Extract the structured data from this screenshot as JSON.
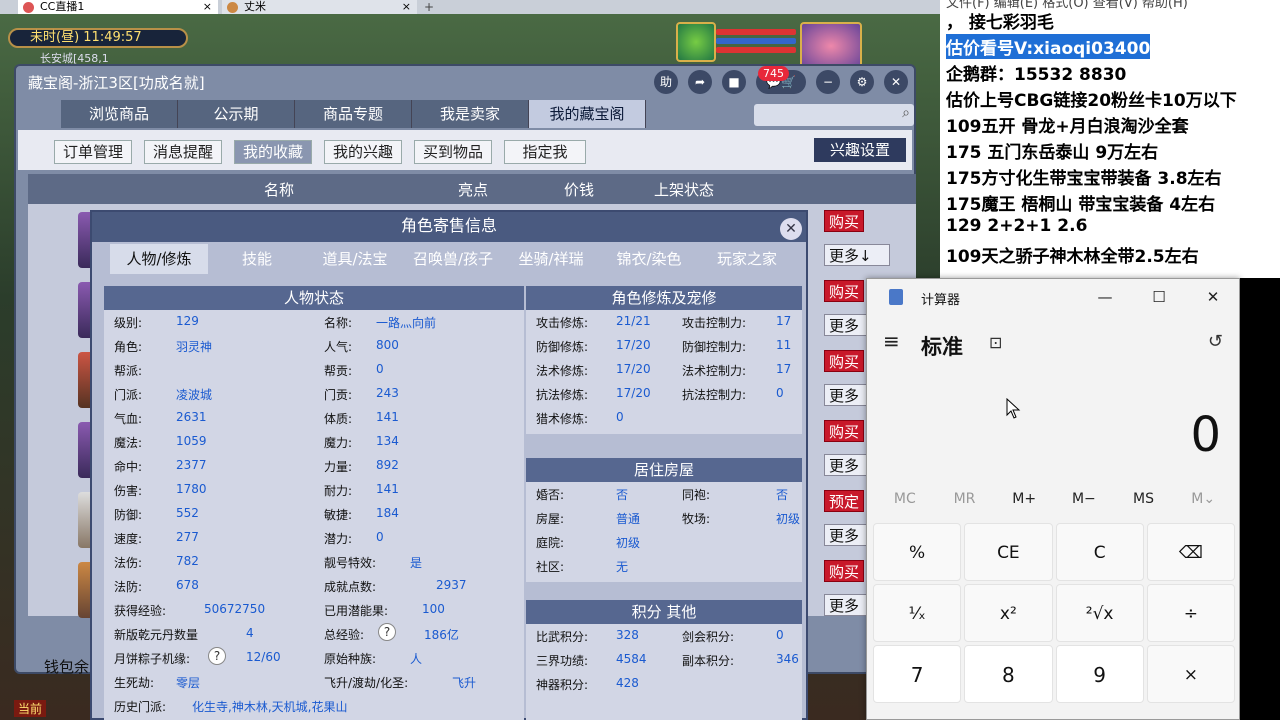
{
  "browser": {
    "tabs": [
      {
        "label": "CC直播1",
        "close": "×"
      },
      {
        "label": "丈米",
        "close": "×"
      }
    ],
    "add": "+"
  },
  "hud": {
    "time": "未时(昼)  11:49:57",
    "location": "长安城[458,1"
  },
  "cbg": {
    "title": "藏宝阁-浙江3区[功成名就]",
    "icons": {
      "help": "助",
      "share": "➦",
      "stop": "■",
      "chat": "💬",
      "cart": "🛒",
      "min": "−",
      "gear": "⚙",
      "close": "✕"
    },
    "badge": "745",
    "nav": [
      "浏览商品",
      "公示期",
      "商品专题",
      "我是卖家",
      "我的藏宝阁"
    ],
    "sub": [
      "订单管理",
      "消息提醒",
      "我的收藏",
      "我的兴趣",
      "买到物品",
      "指定我"
    ],
    "interest": "兴趣设置",
    "cols": [
      "名称",
      "亮点",
      "价钱",
      "上架状态"
    ],
    "buy": [
      "购买",
      "购买",
      "购买",
      "购买",
      "预定",
      "购买"
    ],
    "more": [
      "更多↓",
      "更多",
      "更多",
      "更多",
      "更多",
      "更多"
    ],
    "wallet": "钱包余"
  },
  "role": {
    "title": "角色寄售信息",
    "close": "✕",
    "tabs": [
      "人物/修炼",
      "技能",
      "道具/法宝",
      "召唤兽/孩子",
      "坐骑/祥瑞",
      "锦衣/染色",
      "玩家之家"
    ],
    "status_title": "人物状态",
    "left": [
      [
        "级别:",
        "129"
      ],
      [
        "角色:",
        "羽灵神"
      ],
      [
        "帮派:",
        ""
      ],
      [
        "门派:",
        "凌波城"
      ],
      [
        "气血:",
        "2631"
      ],
      [
        "魔法:",
        "1059"
      ],
      [
        "命中:",
        "2377"
      ],
      [
        "伤害:",
        "1780"
      ],
      [
        "防御:",
        "552"
      ],
      [
        "速度:",
        "277"
      ],
      [
        "法伤:",
        "782"
      ],
      [
        "法防:",
        "678"
      ],
      [
        "获得经验:",
        "50672750"
      ],
      [
        "新版乾元丹数量",
        "4"
      ],
      [
        "月饼粽子机缘:",
        "12/60"
      ],
      [
        "生死劫:",
        "零层"
      ],
      [
        "历史门派:",
        "化生寺,神木林,天机城,花果山"
      ]
    ],
    "mid": [
      [
        "名称:",
        "一路灬向前"
      ],
      [
        "人气:",
        "800"
      ],
      [
        "帮贡:",
        "0"
      ],
      [
        "门贡:",
        "243"
      ],
      [
        "体质:",
        "141"
      ],
      [
        "魔力:",
        "134"
      ],
      [
        "力量:",
        "892"
      ],
      [
        "耐力:",
        "141"
      ],
      [
        "敏捷:",
        "184"
      ],
      [
        "潜力:",
        "0"
      ],
      [
        "靓号特效:",
        "是"
      ],
      [
        "成就点数:",
        "2937"
      ],
      [
        "已用潜能果:",
        "100"
      ],
      [
        "总经验:",
        "186亿"
      ],
      [
        "原始种族:",
        "人"
      ],
      [
        "飞升/渡劫/化圣:",
        "飞升"
      ]
    ],
    "cult_title": "角色修炼及宠修",
    "cult": [
      [
        "攻击修炼:",
        "21/21",
        "攻击控制力:",
        "17"
      ],
      [
        "防御修炼:",
        "17/20",
        "防御控制力:",
        "11"
      ],
      [
        "法术修炼:",
        "17/20",
        "法术控制力:",
        "17"
      ],
      [
        "抗法修炼:",
        "17/20",
        "抗法控制力:",
        "0"
      ],
      [
        "猎术修炼:",
        "0",
        "",
        ""
      ]
    ],
    "house_title": "居住房屋",
    "house": [
      [
        "婚否:",
        "否",
        "同袍:",
        "否"
      ],
      [
        "房屋:",
        "普通",
        "牧场:",
        "初级"
      ],
      [
        "庭院:",
        "初级",
        "",
        ""
      ],
      [
        "社区:",
        "无",
        "",
        ""
      ]
    ],
    "score_title": "积分 其他",
    "score": [
      [
        "比武积分:",
        "328",
        "剑会积分:",
        "0"
      ],
      [
        "三界功绩:",
        "4584",
        "副本积分:",
        "346"
      ],
      [
        "神器积分:",
        "428",
        "",
        ""
      ]
    ],
    "qm": "?"
  },
  "overlay": {
    "top": "文件(F)   编辑(E)   格式(O)   查看(V)   帮助(H)",
    "lines": [
      "，     接七彩羽毛",
      "估价看号V:xiaoqi03400",
      "企鹅群：15532 8830",
      "估价上号CBG链接20粉丝卡10万以下",
      "109五开 骨龙+月白浪淘沙全套",
      "175 五门东岳泰山  9万左右",
      "175方寸化生带宝宝带装备  3.8左右",
      "175魔王 梧桐山  带宝宝装备 4左右",
      "129 2+2+1  2.6",
      "109天之骄子神木林全带2.5左右"
    ]
  },
  "calc": {
    "title": "计算器",
    "mode": "标准",
    "display": "0",
    "mem": [
      "MC",
      "MR",
      "M+",
      "M−",
      "MS",
      "M⌄"
    ],
    "keys": [
      "%",
      "CE",
      "C",
      "⌫",
      "¹⁄ₓ",
      "x²",
      "²√x",
      "÷",
      "7",
      "8",
      "9",
      "×"
    ],
    "win": {
      "min": "—",
      "max": "☐",
      "close": "✕"
    },
    "menu": "≡",
    "keep": "⊡",
    "hist": "↺"
  },
  "bottom": {
    "current": "当前"
  }
}
